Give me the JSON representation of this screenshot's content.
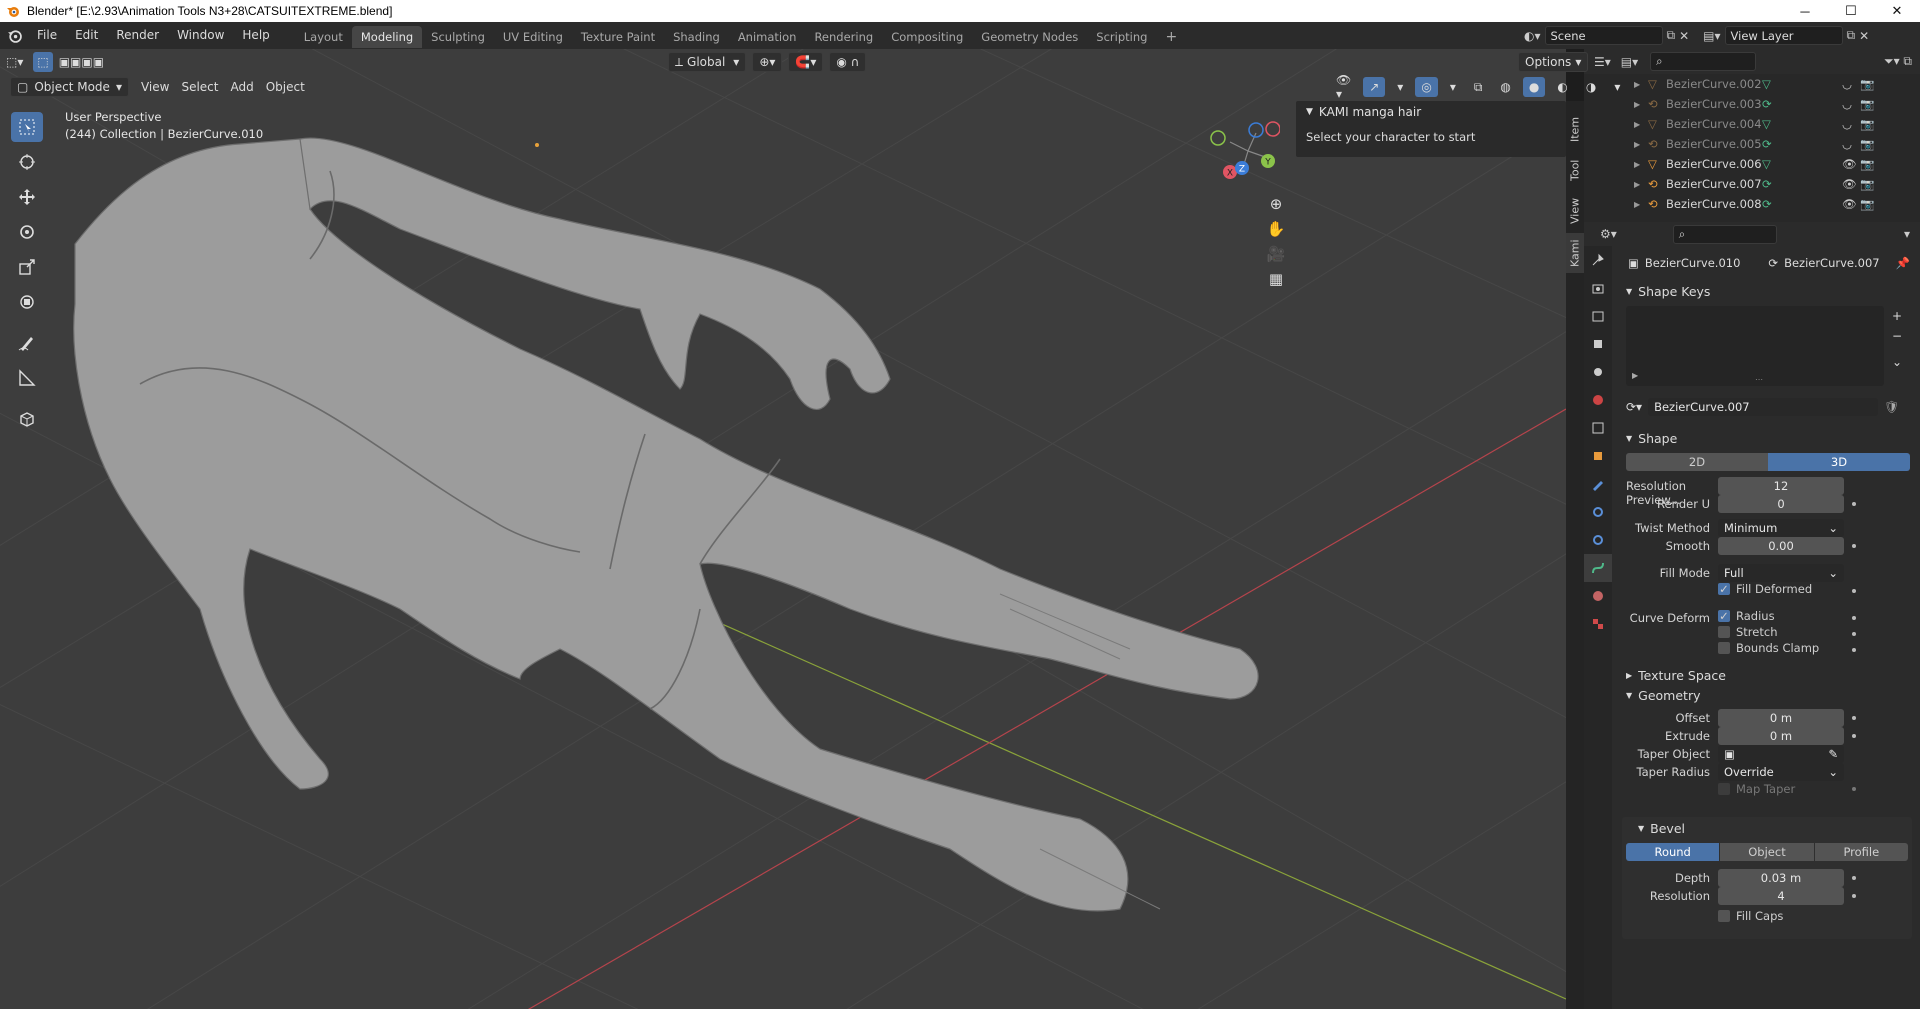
{
  "window": {
    "title": "Blender* [E:\\2.93\\Animation Tools N3+28\\CATSUITEXTREME.blend]",
    "minimize": "─",
    "maximize": "☐",
    "close": "✕"
  },
  "menus": [
    "File",
    "Edit",
    "Render",
    "Window",
    "Help"
  ],
  "workspaces": [
    "Layout",
    "Modeling",
    "Sculpting",
    "UV Editing",
    "Texture Paint",
    "Shading",
    "Animation",
    "Rendering",
    "Compositing",
    "Geometry Nodes",
    "Scripting"
  ],
  "active_workspace": "Modeling",
  "scene": {
    "name": "Scene",
    "view_layer": "View Layer"
  },
  "viewport": {
    "mode": "Object Mode",
    "menus": [
      "View",
      "Select",
      "Add",
      "Object"
    ],
    "transform_orientation": "Global",
    "options_label": "Options",
    "overlay_line1": "User Perspective",
    "overlay_line2": "(244) Collection | BezierCurve.010"
  },
  "kami_panel": {
    "title": "KAMI manga hair",
    "message": "Select your character to start"
  },
  "n_tabs": [
    "Item",
    "Tool",
    "View",
    "Kami"
  ],
  "outliner": {
    "items": [
      {
        "name": "BezierCurve.002",
        "visible": false
      },
      {
        "name": "BezierCurve.003",
        "visible": false
      },
      {
        "name": "BezierCurve.004",
        "visible": false
      },
      {
        "name": "BezierCurve.005",
        "visible": false
      },
      {
        "name": "BezierCurve.006",
        "visible": true
      },
      {
        "name": "BezierCurve.007",
        "visible": true
      },
      {
        "name": "BezierCurve.008",
        "visible": true
      }
    ]
  },
  "properties": {
    "object_name": "BezierCurve.010",
    "data_name": "BezierCurve.007",
    "shape_keys_label": "Shape Keys",
    "datablock": "BezierCurve.007",
    "shape": {
      "title": "Shape",
      "dim_2d": "2D",
      "dim_3d": "3D",
      "resolution_preview_label": "Resolution Preview...",
      "resolution_preview": "12",
      "render_u_label": "Render U",
      "render_u": "0",
      "twist_method_label": "Twist Method",
      "twist_method": "Minimum",
      "smooth_label": "Smooth",
      "smooth": "0.00",
      "fill_mode_label": "Fill Mode",
      "fill_mode": "Full",
      "fill_deformed": "Fill Deformed",
      "curve_deform_label": "Curve Deform",
      "radius": "Radius",
      "stretch": "Stretch",
      "bounds_clamp": "Bounds Clamp"
    },
    "texture_space": "Texture Space",
    "geometry": {
      "title": "Geometry",
      "offset_label": "Offset",
      "offset": "0 m",
      "extrude_label": "Extrude",
      "extrude": "0 m",
      "taper_object_label": "Taper Object",
      "taper_radius_label": "Taper Radius",
      "taper_radius": "Override",
      "map_taper": "Map Taper"
    },
    "bevel": {
      "title": "Bevel",
      "round": "Round",
      "object": "Object",
      "profile": "Profile",
      "depth_label": "Depth",
      "depth": "0.03 m",
      "resolution_label": "Resolution",
      "resolution": "4",
      "fill_caps": "Fill Caps"
    }
  }
}
